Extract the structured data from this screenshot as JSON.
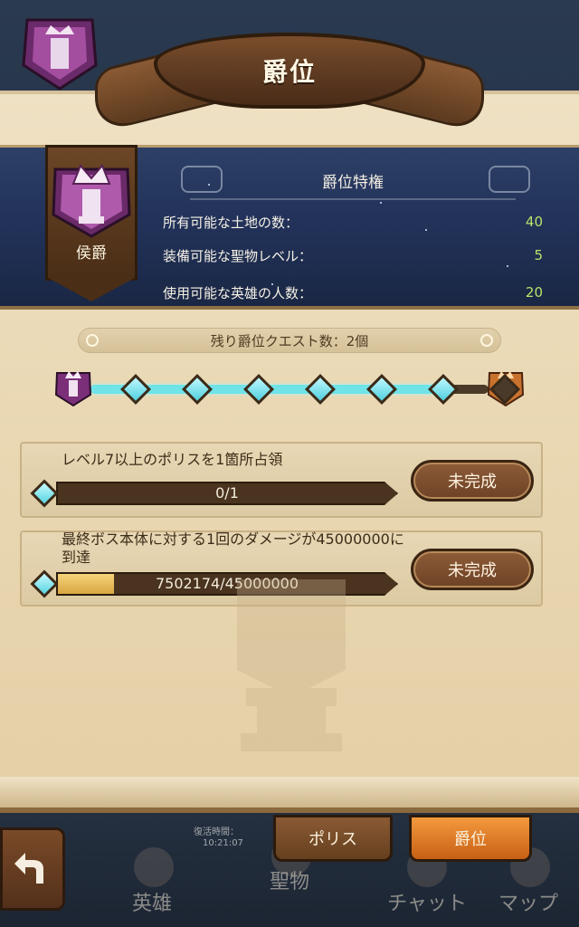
{
  "header": {
    "title": "爵位"
  },
  "privileges": {
    "title": "爵位特権",
    "rank_name": "侯爵",
    "rows": [
      {
        "label": "所有可能な土地の数：",
        "value": "40"
      },
      {
        "label": "装備可能な聖物レベル：",
        "value": "5"
      },
      {
        "label": "使用可能な英雄の人数：",
        "value": "20"
      }
    ]
  },
  "remaining_quests": "残り爵位クエスト数：2個",
  "progress": {
    "total_nodes": 7,
    "completed_nodes": 6
  },
  "quests": [
    {
      "text": "レベル7以上のポリスを1箇所占領",
      "progress_text": "0/1",
      "progress_fraction": 0.0,
      "status": "未完成"
    },
    {
      "text": "最終ボス本体に対する1回のダメージが45000000に到達",
      "progress_text": "7502174/45000000",
      "progress_fraction": 0.167,
      "status": "未完成"
    }
  ],
  "tabs": {
    "polis": "ポリス",
    "rank": "爵位"
  },
  "nav": {
    "heroes": "英雄",
    "relics": "聖物",
    "chat": "チャット",
    "map": "マップ"
  },
  "background_text": {
    "revive_time": "復活時間：",
    "clock": "10:21:07"
  },
  "colors": {
    "accent_cyan": "#6fe3e8",
    "value_green": "#b9e36a",
    "active_tab": "#f39a3e"
  }
}
